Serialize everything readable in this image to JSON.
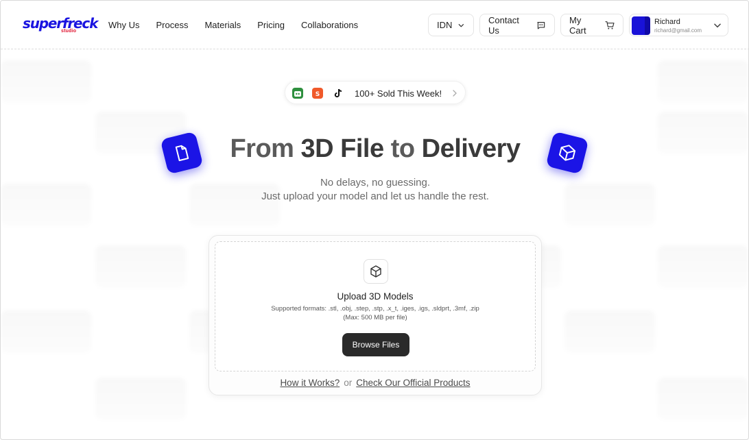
{
  "brand": {
    "logo_text": "superfreck",
    "logo_sub": "studio",
    "primary_color": "#1b14e6",
    "accent_red": "#e0142f"
  },
  "nav": {
    "items": [
      "Why Us",
      "Process",
      "Materials",
      "Pricing",
      "Collaborations"
    ]
  },
  "header": {
    "language": "IDN",
    "contact_label": "Contact Us",
    "cart_label": "My Cart",
    "user": {
      "name": "Richard",
      "email": "richard@gmail.com"
    }
  },
  "badge": {
    "text": "100+ Sold This Week!",
    "icons": [
      "tokopedia-icon",
      "shopee-icon",
      "tiktok-icon"
    ]
  },
  "hero": {
    "title_part1": "From ",
    "title_bold1": "3D File",
    "title_part2": " to ",
    "title_bold2": "Delivery",
    "subtitle_line1": "No delays, no guessing.",
    "subtitle_line2": "Just upload your model and let us handle the rest."
  },
  "upload": {
    "title": "Upload 3D Models",
    "formats": "Supported formats: .stl, .obj, .step, .stp, .x_t, .iges, .igs, .sldprt, .3mf, .zip",
    "max": "(Max: 500 MB per file)",
    "browse_label": "Browse Files"
  },
  "footer_links": {
    "how_it_works": "How it Works?",
    "or": "or",
    "official_products": "Check Our Official Products"
  }
}
